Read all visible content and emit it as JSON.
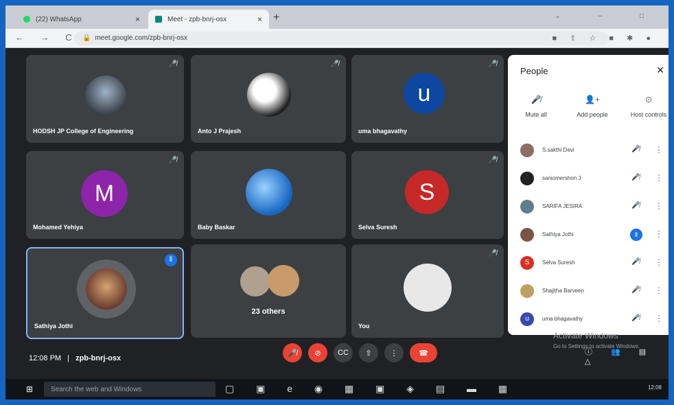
{
  "browser": {
    "tab1": {
      "title": "(22) WhatsApp",
      "close": "×"
    },
    "tab2": {
      "title": "Meet - zpb-bnrj-osx",
      "close": "×"
    },
    "new_tab": "+",
    "url": "meet.google.com/zpb-bnrj-osx",
    "nav": "← → C",
    "window_controls": "⌄ – □"
  },
  "tiles": [
    {
      "name": "HODSH JP College of Engineering"
    },
    {
      "name": "Anto J Prajesh"
    },
    {
      "name": "uma bhagavathy",
      "initial": "u"
    },
    {
      "name": "Mohamed Yehiya",
      "initial": "M"
    },
    {
      "name": "Baby Baskar"
    },
    {
      "name": "Selva Suresh",
      "initial": "S"
    },
    {
      "name": "Sathiya Jothi"
    },
    {
      "name": "23 others"
    },
    {
      "name": "You"
    }
  ],
  "people_panel": {
    "title": "People",
    "actions": [
      "Mute all",
      "Add people",
      "Host controls"
    ],
    "participants": [
      {
        "name": "S.sakthi Devi",
        "color": "#8d6e63",
        "initial": ""
      },
      {
        "name": "saniomershon J",
        "color": "#212121",
        "initial": ""
      },
      {
        "name": "SARIFA JESIRA",
        "color": "#607d8b",
        "initial": ""
      },
      {
        "name": "Sathiya Jothi",
        "color": "#795548",
        "initial": ""
      },
      {
        "name": "Selva Suresh",
        "color": "#d93025",
        "initial": "S"
      },
      {
        "name": "Shajitha Barveen",
        "color": "#c0a062",
        "initial": ""
      },
      {
        "name": "uma bhagavathy",
        "color": "#3949ab",
        "initial": "u"
      }
    ]
  },
  "meeting": {
    "time": "12:08 PM",
    "separator": "|",
    "code": "zpb-bnrj-osx"
  },
  "windows": {
    "activate_title": "Activate Windows",
    "activate_sub": "Go to Settings to activate Windows.",
    "search_placeholder": "Search the web and Windows",
    "clock": "12:08"
  },
  "colors": {
    "accent": "#1a73e8",
    "danger": "#ea4335",
    "tile_bg": "#3c4043"
  }
}
